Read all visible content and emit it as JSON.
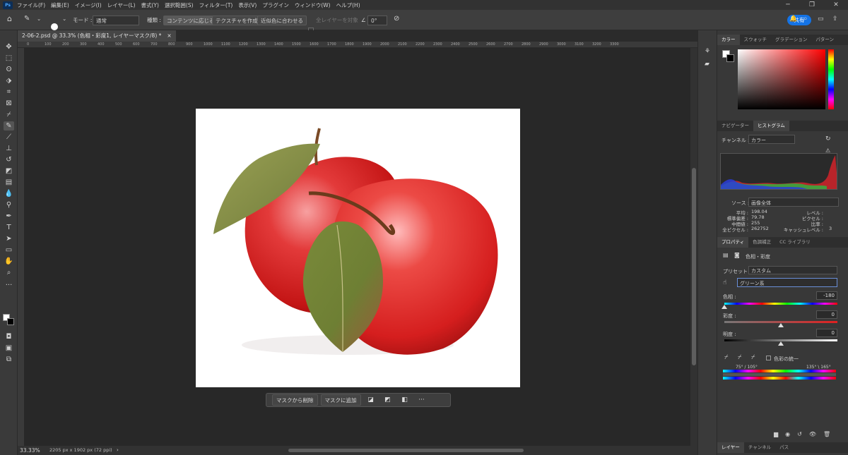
{
  "menu": {
    "logo": "Ps",
    "items": [
      "ファイル(F)",
      "編集(E)",
      "イメージ(I)",
      "レイヤー(L)",
      "書式(Y)",
      "選択範囲(S)",
      "フィルター(T)",
      "表示(V)",
      "プラグイン",
      "ウィンドウ(W)",
      "ヘルプ(H)"
    ]
  },
  "options": {
    "brush_size": "56",
    "mode_label": "モード :",
    "mode_value": "通常",
    "type_label": "種類 :",
    "type_options": [
      "コンテンツに応じる",
      "テクスチャを作成",
      "近似色に合わせる"
    ],
    "sample_all": "全レイヤーを対象",
    "angle": "0°",
    "share": "共有"
  },
  "document": {
    "tab_title": "2-06-2.psd @ 33.3% (色相・彩度1, レイヤーマスク/8) *",
    "close": "×"
  },
  "ruler": [
    "0",
    "100",
    "200",
    "300",
    "400",
    "500",
    "600",
    "700",
    "800",
    "900",
    "1000",
    "1100",
    "1200",
    "1300",
    "1400",
    "1500",
    "1600",
    "1700",
    "1800",
    "1900",
    "2000",
    "2100",
    "2200",
    "2300",
    "2400",
    "2500",
    "2600",
    "2700",
    "2800",
    "2900",
    "3000",
    "3100",
    "3200",
    "3300"
  ],
  "context_bar": {
    "subtract": "マスクから削除",
    "add": "マスクに追加"
  },
  "status": {
    "zoom": "33.33%",
    "size": "2205 px x 1902 px (72 ppi)"
  },
  "color_panel": {
    "tabs": [
      "カラー",
      "スウォッチ",
      "グラデーション",
      "パターン"
    ],
    "hue_color": "#ff0000"
  },
  "histogram": {
    "tabs": [
      "ナビゲーター",
      "ヒストグラム"
    ],
    "channel_label": "チャンネル :",
    "channel_value": "カラー",
    "source_label": "ソース :",
    "source_value": "画像全体",
    "stats": [
      {
        "label": "平均 :",
        "value": "198.04"
      },
      {
        "label": "標準偏差 :",
        "value": "79.78"
      },
      {
        "label": "中間値 :",
        "value": "255"
      },
      {
        "label": "全ピクセル :",
        "value": "262752"
      }
    ],
    "stats_right": [
      {
        "label": "レベル :",
        "value": ""
      },
      {
        "label": "ピクセル :",
        "value": ""
      },
      {
        "label": "比率 :",
        "value": ""
      },
      {
        "label": "キャッシュレベル :",
        "value": "3"
      }
    ]
  },
  "properties": {
    "tabs": [
      "プロパティ",
      "色調補正",
      "CC ライブラリ"
    ],
    "adjustment": "色相・彩度",
    "preset_label": "プリセット :",
    "preset_value": "カスタム",
    "range_value": "グリーン系",
    "hue_label": "色相 :",
    "hue_value": "-180",
    "sat_label": "彩度 :",
    "sat_value": "0",
    "light_label": "明度 :",
    "light_value": "0",
    "colorize": "色彩の統一",
    "range_left": "75° / 105°",
    "range_right": "135° \\ 165°",
    "hue_level": 0.0,
    "sat_level": 0.5,
    "light_level": 0.5
  },
  "layers_tabs": [
    "レイヤー",
    "チャンネル",
    "パス"
  ]
}
